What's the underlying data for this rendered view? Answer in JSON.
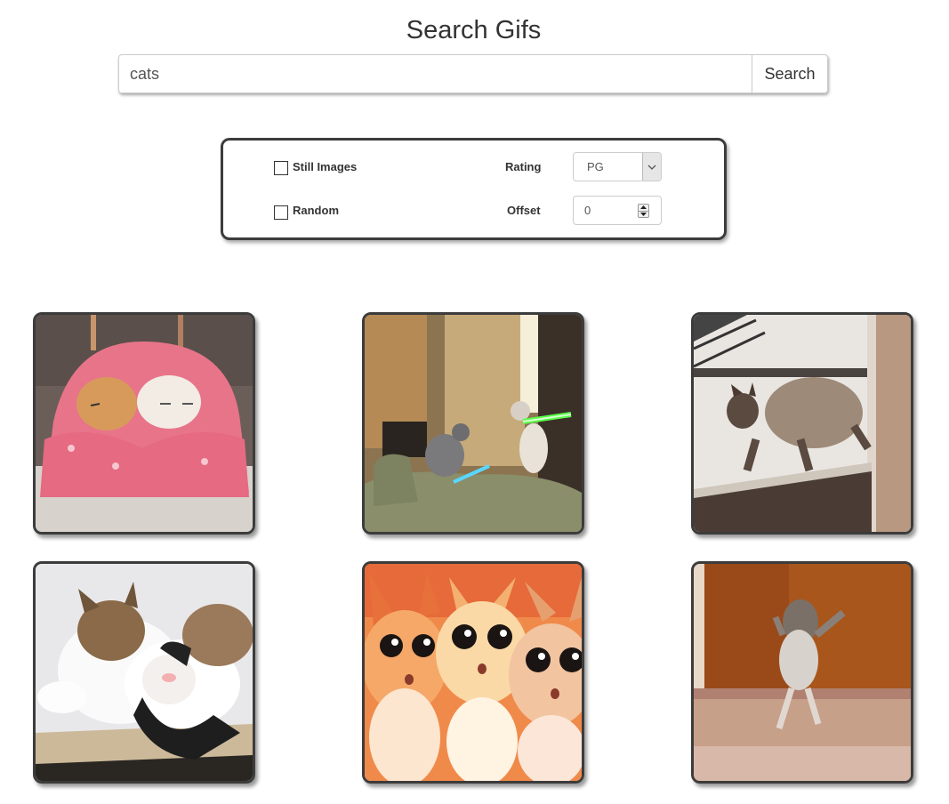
{
  "header": {
    "title": "Search Gifs"
  },
  "search": {
    "value": "cats",
    "button_label": "Search"
  },
  "options": {
    "still_images_label": "Still Images",
    "still_images_checked": false,
    "random_label": "Random",
    "random_checked": false,
    "rating_label": "Rating",
    "rating_value": "PG",
    "offset_label": "Offset",
    "offset_value": "0"
  },
  "results": [
    {
      "subject": "two kittens wrapped in a pink blanket"
    },
    {
      "subject": "cats dueling with lightsabers"
    },
    {
      "subject": "siamese cat jumping off a ledge"
    },
    {
      "subject": "calico cat hugging a black and white cat"
    },
    {
      "subject": "three big-eyed cartoon kittens"
    },
    {
      "subject": "cat standing on hind legs dancing"
    }
  ]
}
